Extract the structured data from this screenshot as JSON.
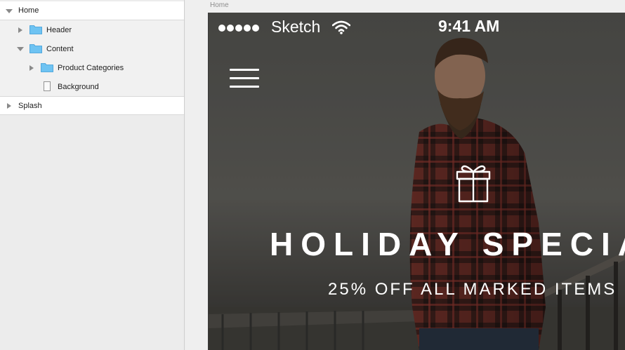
{
  "layers": {
    "items": [
      {
        "label": "Home",
        "state": "expanded",
        "icon": "none"
      },
      {
        "label": "Header",
        "state": "collapsed",
        "icon": "folder-icon"
      },
      {
        "label": "Content",
        "state": "expanded",
        "icon": "folder-icon"
      },
      {
        "label": "Product Categories",
        "state": "collapsed",
        "icon": "folder-icon"
      },
      {
        "label": "Background",
        "state": "leaf",
        "icon": "page-icon"
      },
      {
        "label": "Splash",
        "state": "collapsed",
        "icon": "none"
      }
    ]
  },
  "canvas": {
    "artboard_name": "Home"
  },
  "statusbar": {
    "carrier": "Sketch",
    "time": "9:41 AM",
    "signal_dots": 5
  },
  "promo": {
    "title": "HOLIDAY SPECIA",
    "subtitle": "25% OFF ALL MARKED ITEMS"
  },
  "colors": {
    "sidebar_bg": "#ececec",
    "selected_row": "#ffffff",
    "folder_blue": "#5fb8ee",
    "overlay_text": "#ffffff"
  }
}
